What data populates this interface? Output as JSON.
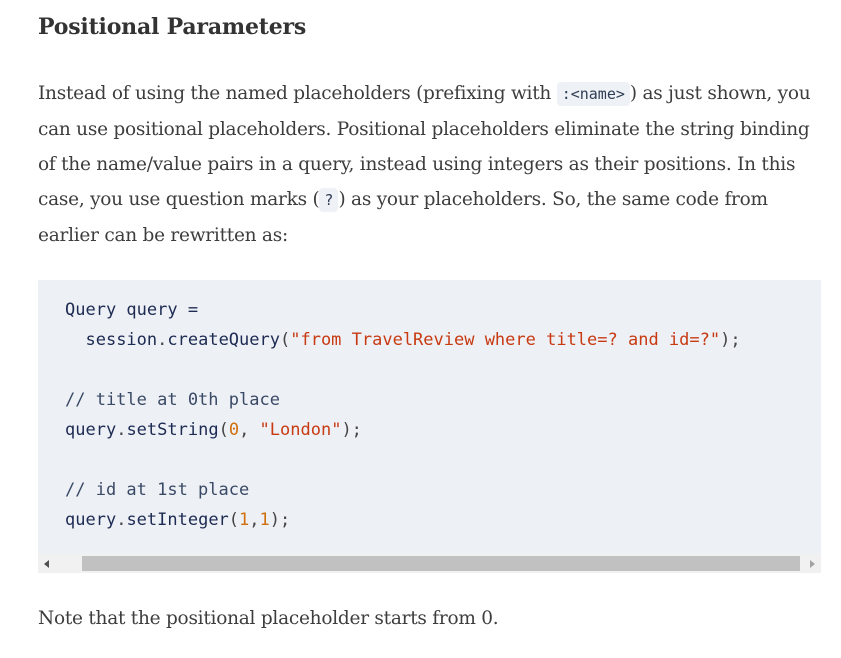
{
  "section": {
    "heading": "Positional Parameters"
  },
  "intro": {
    "part1": "Instead of using the named placeholders (prefixing with ",
    "code1": ":<name>",
    "part2": ") as just shown, you can use positional placeholders. Positional placeholders eliminate the string binding of the name/value pairs in a query, instead using integers as their positions. In this case, you use question marks (",
    "code2": "?",
    "part3": ") as your placeholders. So, the same code from earlier can be rewritten as:"
  },
  "code_block": {
    "line1_var": "Query query =",
    "line2_obj": "session",
    "line2_dot": ".",
    "line2_method": "createQuery",
    "line2_open": "(",
    "line2_str": "\"from TravelReview where title=? and id=?\"",
    "line2_close": ");",
    "line4_comment": "// title at 0th place",
    "line5_obj": "query",
    "line5_dot": ".",
    "line5_method": "setString",
    "line5_open": "(",
    "line5_num": "0",
    "line5_comma": ", ",
    "line5_str": "\"London\"",
    "line5_close": ");",
    "line7_comment": "// id at 1st place",
    "line8_obj": "query",
    "line8_dot": ".",
    "line8_method": "setInteger",
    "line8_open": "(",
    "line8_num1": "1",
    "line8_comma": ",",
    "line8_num2": "1",
    "line8_close": ");"
  },
  "note": {
    "text": "Note that the positional placeholder starts from 0."
  },
  "colors": {
    "code_bg": "#edf0f5",
    "string": "#c83a12",
    "number": "#d06f0e",
    "identifier": "#1d2a52"
  }
}
